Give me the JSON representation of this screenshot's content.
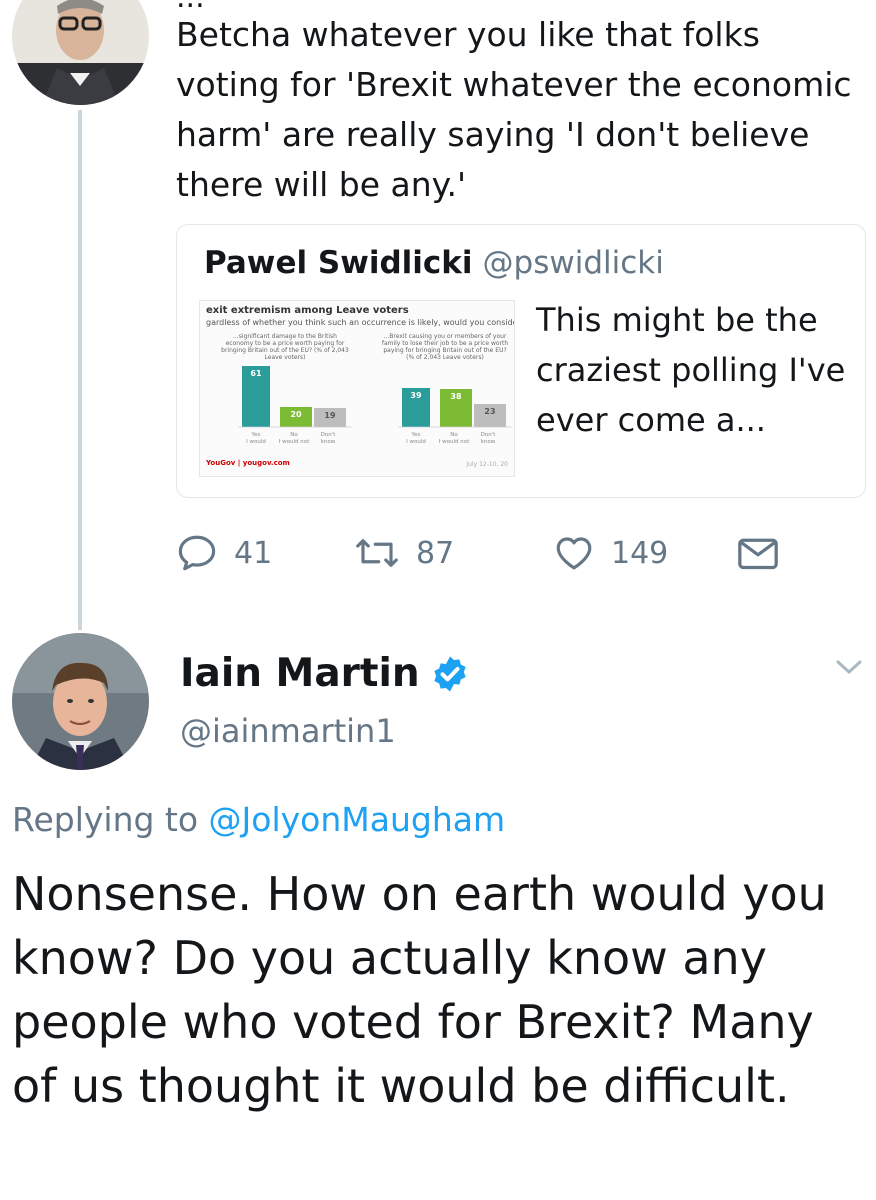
{
  "top_tweet": {
    "clipped_header": "...",
    "text": "Betcha whatever you like that folks voting for 'Brexit whatever the economic harm' are really saying 'I don't believe there will be any.'",
    "quote": {
      "name": "Pawel Swidlicki",
      "handle": "@pswidlicki",
      "text": "This might be the craziest polling I've ever come a...",
      "thumbnail": {
        "title": "exit extremism among Leave voters",
        "subtitle": "gardless of whether you think such an occurrence is likely, would you consider...",
        "panels": [
          {
            "caption": "...significant damage to the British economy to be a price worth paying for bringing Britain out of the EU? (% of 2,043 Leave voters)"
          },
          {
            "caption": "...Brexit causing you or members of your family to lose their job to be a price worth paying for bringing Britain out of the EU? (% of 2,043 Leave voters)"
          }
        ],
        "footer_brand": "YouGov | yougov.com",
        "footer_date": "July 12-10, 20",
        "chart_data": {
          "type": "bar",
          "categories": [
            "Yes I would",
            "No I would not",
            "Don't know"
          ],
          "series": [
            {
              "values": [
                61,
                20,
                19
              ],
              "colors": [
                "#2a9d9a",
                "#7dbb34",
                "#bdbdbd"
              ]
            },
            {
              "values": [
                39,
                38,
                23
              ],
              "colors": [
                "#2a9d9a",
                "#7dbb34",
                "#bdbdbd"
              ]
            }
          ],
          "ylim": [
            0,
            70
          ]
        }
      }
    },
    "actions": {
      "reply_count": "41",
      "retweet_count": "87",
      "like_count": "149"
    }
  },
  "main_tweet": {
    "author_name": "Iain Martin",
    "author_handle": "@iainmartin1",
    "verified": true,
    "replying_prefix": "Replying to",
    "replying_to": "@JolyonMaugham",
    "text": "Nonsense. How on earth would you know? Do you actually know any people who voted for Brexit? Many of us thought it would be difficult."
  },
  "colors": {
    "link": "#1da1f2",
    "muted": "#657786",
    "thread_line": "#ccd6dd"
  },
  "icons": [
    "reply-icon",
    "retweet-icon",
    "like-icon",
    "share-mail-icon",
    "verified-badge-icon",
    "chevron-down-icon"
  ]
}
